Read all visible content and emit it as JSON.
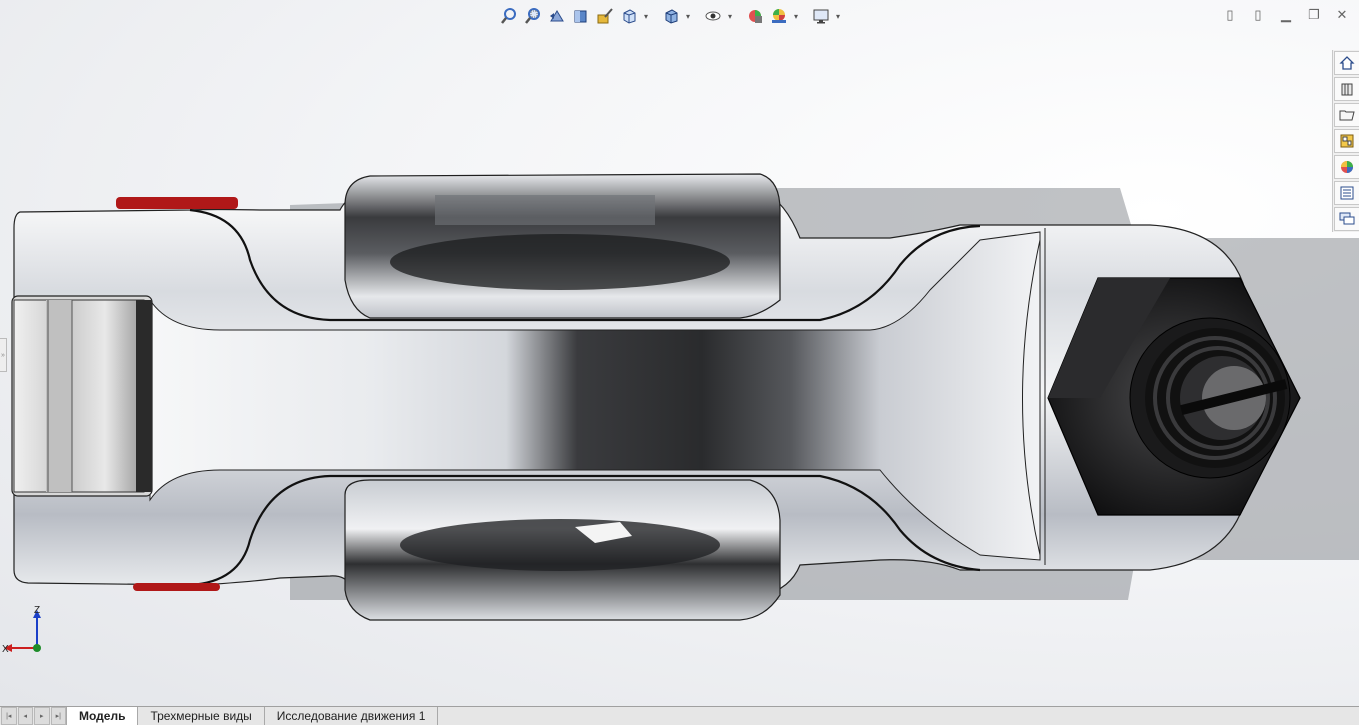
{
  "toolbar": {
    "icons": [
      "zoom-to-fit",
      "zoom-to-area",
      "previous-view",
      "section-view",
      "dynamic-annotation",
      "view-orientation",
      "display-style",
      "hide-show-items",
      "edit-appearance",
      "apply-scene",
      "view-settings"
    ]
  },
  "window_controls": [
    "tile-left",
    "tile-right",
    "minimize",
    "restore",
    "close"
  ],
  "window_glyphs": {
    "tile_left": "▯",
    "tile_right": "▯",
    "minimize": "▁",
    "restore": "❐",
    "close": "✕"
  },
  "task_pane": [
    "solidworks-resources",
    "design-library",
    "file-explorer",
    "view-palette",
    "appearances-scenes-decals",
    "custom-properties",
    "solidworks-forum"
  ],
  "triad": {
    "z_label": "Z",
    "x_label": "X"
  },
  "tabs": {
    "model": "Модель",
    "views_3d": "Трехмерные виды",
    "motion_study": "Исследование движения 1"
  },
  "colors": {
    "accent_red": "#b01818",
    "axis_blue": "#1a3fc8",
    "axis_red": "#cc1f1f",
    "axis_green": "#1e8c2a",
    "background": "#eceef1"
  }
}
